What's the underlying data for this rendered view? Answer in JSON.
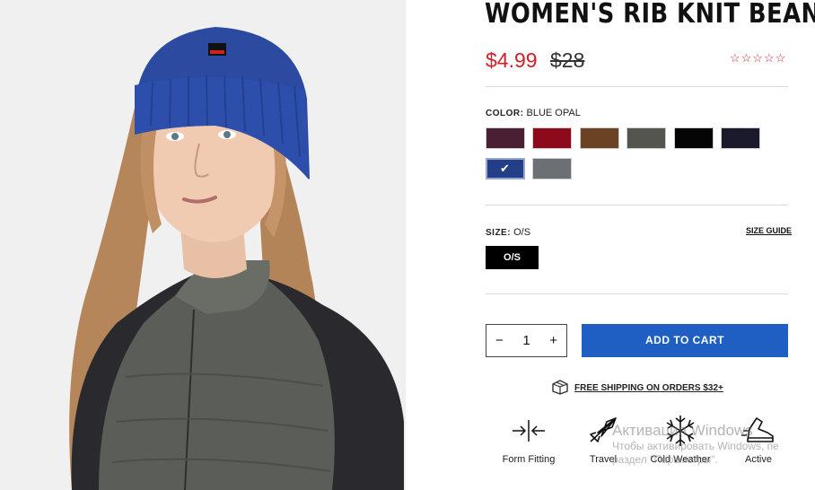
{
  "product": {
    "title": "WOMEN'S RIB KNIT BEANIE",
    "price": "$4.99",
    "old_price": "$28",
    "rating_stars": "☆☆☆☆☆"
  },
  "color": {
    "label": "COLOR:",
    "value": "BLUE OPAL",
    "swatches": [
      {
        "name": "plum",
        "hex": "#4a1f33"
      },
      {
        "name": "red",
        "hex": "#8c0a1c"
      },
      {
        "name": "brown",
        "hex": "#6b4324"
      },
      {
        "name": "olive gray",
        "hex": "#55554f"
      },
      {
        "name": "black",
        "hex": "#050505"
      },
      {
        "name": "navy",
        "hex": "#1b1a2d"
      },
      {
        "name": "blue opal",
        "hex": "#233f8a",
        "selected": true
      },
      {
        "name": "gray",
        "hex": "#6c7075"
      }
    ]
  },
  "size": {
    "label": "SIZE:",
    "value": "O/S",
    "guide_label": "SIZE GUIDE",
    "options": [
      "O/S"
    ]
  },
  "cart": {
    "minus": "−",
    "quantity": "1",
    "plus": "+",
    "add_label": "ADD TO CART"
  },
  "shipping": {
    "text": "FREE SHIPPING ON ORDERS $32+"
  },
  "features": [
    {
      "label": "Form Fitting",
      "icon": "form-fitting-icon"
    },
    {
      "label": "Travel",
      "icon": "airplane-icon"
    },
    {
      "label": "Cold Weather",
      "icon": "snowflake-icon"
    },
    {
      "label": "Active",
      "icon": "sneaker-icon"
    }
  ],
  "watermark": {
    "line1": "Активация Windows",
    "line2": "Чтобы активировать Windows, пе",
    "line3": "раздел \"Параметры\"."
  },
  "colors": {
    "accent_red": "#d4202b",
    "cart_blue": "#1f5fc4"
  }
}
